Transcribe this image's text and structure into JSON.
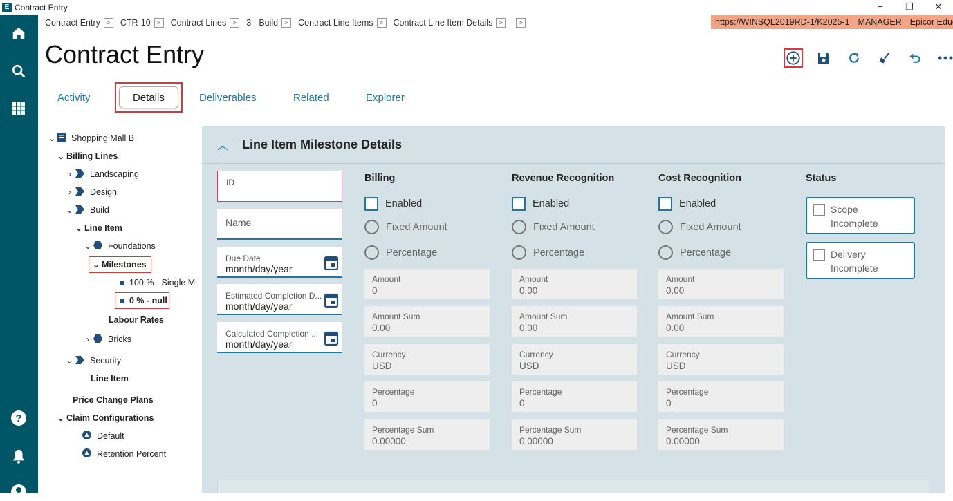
{
  "window": {
    "title": "Contract Entry",
    "app_logo": "E",
    "controls": [
      "−",
      "❐",
      "✕"
    ]
  },
  "rail": {
    "icons": [
      "home-icon",
      "search-icon",
      "apps-grid-icon",
      "help-icon",
      "bell-icon",
      "user-icon"
    ]
  },
  "breadcrumb": [
    "Contract Entry",
    "CTR-10",
    "Contract Lines",
    "3 - Build",
    "Contract Line Items",
    "Contract Line Item Details",
    ""
  ],
  "server": {
    "url": "https://WINSQL2019RD-1/K2025-1",
    "user": "MANAGER",
    "company": "Epicor Education"
  },
  "page_title": "Contract Entry",
  "toolbar": {
    "icons": [
      "add-new-icon",
      "save-icon",
      "refresh-icon",
      "clear-icon",
      "undo-icon",
      "more-icon"
    ]
  },
  "tabs": {
    "activity": "Activity",
    "details": "Details",
    "deliverables": "Deliverables",
    "related": "Related",
    "explorer": "Explorer"
  },
  "tree": {
    "root": "Shopping Mall B",
    "billing_lines": "Billing Lines",
    "landscaping": "Landscaping",
    "design": "Design",
    "build": "Build",
    "line_item": "Line Item",
    "foundations": "Foundations",
    "milestones": "Milestones",
    "m1": "100 % - Single M",
    "m2": "0 % - null",
    "labour_rates": "Labour Rates",
    "bricks": "Bricks",
    "security": "Security",
    "line_item2": "Line Item",
    "price_change_plans": "Price Change Plans",
    "claim_configurations": "Claim Configurations",
    "default": "Default",
    "retention_percent": "Retention Percent"
  },
  "panel": {
    "title": "Line Item Milestone Details",
    "id_label": "ID",
    "name_label": "Name",
    "due_date_label": "Due Date",
    "due_date_value": "month/day/year",
    "est_label": "Estimated Completion D...",
    "est_value": "month/day/year",
    "calc_label": "Calculated Completion ...",
    "calc_value": "month/day/year"
  },
  "columns": [
    {
      "title": "Billing",
      "enabled": "Enabled",
      "fixed": "Fixed Amount",
      "pct": "Percentage",
      "amount_label": "Amount",
      "amount": "0",
      "sum_label": "Amount Sum",
      "sum": "0.00",
      "cur_label": "Currency",
      "cur": "USD",
      "p_label": "Percentage",
      "p": "0",
      "ps_label": "Percentage Sum",
      "ps": "0.00000"
    },
    {
      "title": "Revenue Recognition",
      "enabled": "Enabled",
      "fixed": "Fixed Amount",
      "pct": "Percentage",
      "amount_label": "Amount",
      "amount": "0.00",
      "sum_label": "Amount Sum",
      "sum": "0.00",
      "cur_label": "Currency",
      "cur": "USD",
      "p_label": "Percentage",
      "p": "0",
      "ps_label": "Percentage Sum",
      "ps": "0.00000"
    },
    {
      "title": "Cost Recognition",
      "enabled": "Enabled",
      "fixed": "Fixed Amount",
      "pct": "Percentage",
      "amount_label": "Amount",
      "amount": "0.00",
      "sum_label": "Amount Sum",
      "sum": "0.00",
      "cur_label": "Currency",
      "cur": "USD",
      "p_label": "Percentage",
      "p": "0",
      "ps_label": "Percentage Sum",
      "ps": "0.00000"
    }
  ],
  "status": {
    "title": "Status",
    "scope": "Scope Incomplete",
    "delivery": "Delivery Incomplete"
  },
  "colors": {
    "rail": "#005566",
    "accent": "#1f78a4",
    "highlight": "#d9383c",
    "panel_bg": "#d4e2e7",
    "server_bg": "#f2a586"
  }
}
